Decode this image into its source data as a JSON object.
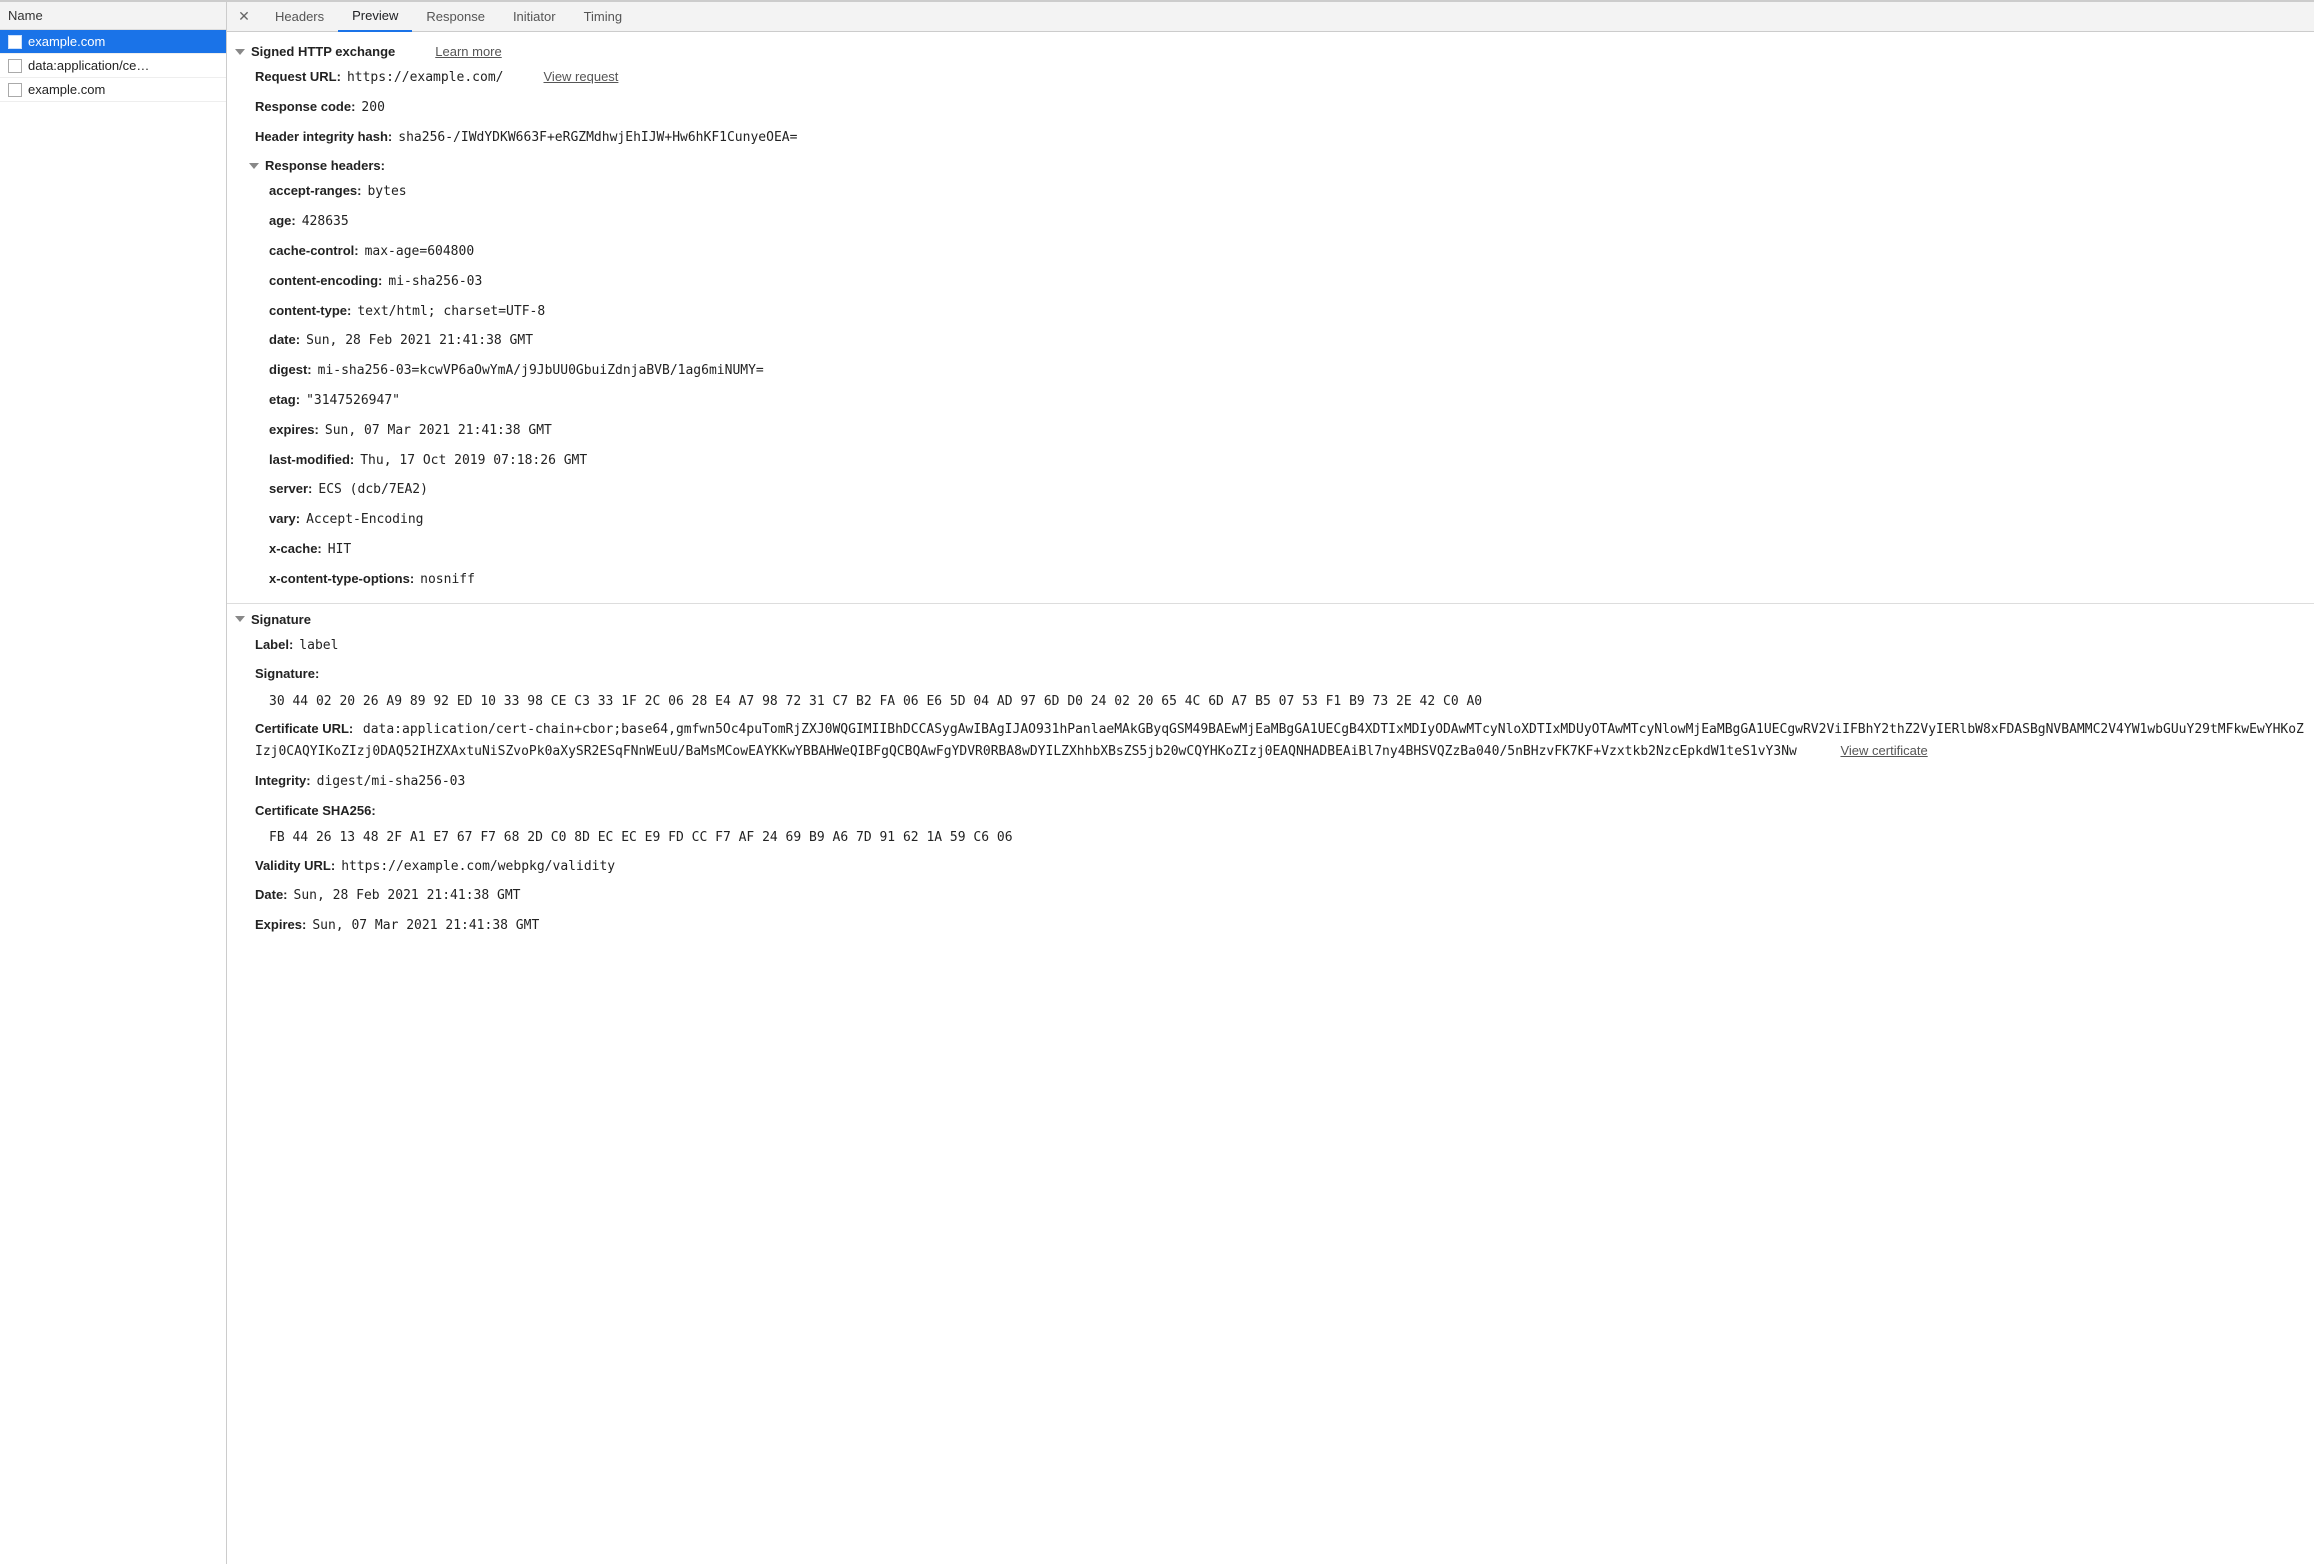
{
  "sidebar": {
    "header": "Name",
    "items": [
      {
        "label": "example.com",
        "selected": true
      },
      {
        "label": "data:application/ce…",
        "selected": false
      },
      {
        "label": "example.com",
        "selected": false
      }
    ]
  },
  "tabs": [
    "Headers",
    "Preview",
    "Response",
    "Initiator",
    "Timing"
  ],
  "active_tab": "Preview",
  "exchange": {
    "title": "Signed HTTP exchange",
    "learn_more": "Learn more",
    "request_url_label": "Request URL:",
    "request_url": "https://example.com/",
    "view_request": "View request",
    "response_code_label": "Response code:",
    "response_code": "200",
    "hih_label": "Header integrity hash:",
    "hih": "sha256-/IWdYDKW663F+eRGZMdhwjEhIJW+Hw6hKF1CunyeOEA=",
    "response_headers_label": "Response headers:",
    "headers": [
      {
        "k": "accept-ranges:",
        "v": "bytes"
      },
      {
        "k": "age:",
        "v": "428635"
      },
      {
        "k": "cache-control:",
        "v": "max-age=604800"
      },
      {
        "k": "content-encoding:",
        "v": "mi-sha256-03"
      },
      {
        "k": "content-type:",
        "v": "text/html; charset=UTF-8"
      },
      {
        "k": "date:",
        "v": "Sun, 28 Feb 2021 21:41:38 GMT"
      },
      {
        "k": "digest:",
        "v": "mi-sha256-03=kcwVP6aOwYmA/j9JbUU0GbuiZdnjaBVB/1ag6miNUMY="
      },
      {
        "k": "etag:",
        "v": "\"3147526947\""
      },
      {
        "k": "expires:",
        "v": "Sun, 07 Mar 2021 21:41:38 GMT"
      },
      {
        "k": "last-modified:",
        "v": "Thu, 17 Oct 2019 07:18:26 GMT"
      },
      {
        "k": "server:",
        "v": "ECS (dcb/7EA2)"
      },
      {
        "k": "vary:",
        "v": "Accept-Encoding"
      },
      {
        "k": "x-cache:",
        "v": "HIT"
      },
      {
        "k": "x-content-type-options:",
        "v": "nosniff"
      }
    ]
  },
  "signature": {
    "title": "Signature",
    "label_label": "Label:",
    "label": "label",
    "signature_label": "Signature:",
    "signature_hex": "30 44 02 20 26 A9 89 92 ED 10 33 98 CE C3 33 1F 2C 06 28 E4 A7 98 72 31 C7 B2 FA 06 E6 5D 04 AD 97 6D D0 24 02 20 65 4C 6D A7 B5 07 53 F1 B9 73 2E 42 C0 A0",
    "cert_url_label": "Certificate URL:",
    "cert_url": "data:application/cert-chain+cbor;base64,gmfwn5Oc4puTomRjZXJ0WQGIMIIBhDCCASygAwIBAgIJAO931hPanlaeMAkGByqGSM49BAEwMjEaMBgGA1UECgB4XDTIxMDIyODAwMTcyNloXDTIxMDUyOTAwMTcyNlowMjEaMBgGA1UECgwRV2ViIFBhY2thZ2VyIERlbW8xFDASBgNVBAMMC2V4YW1wbGUuY29tMFkwEwYHKoZIzj0CAQYIKoZIzj0DAQ52IHZXAxtuNiSZvoPk0aXySR2ESqFNnWEuU/BaMsMCowEAYKKwYBBAHWeQIBFgQCBQAwFgYDVR0RBA8wDYILZXhhbXBsZS5jb20wCQYHKoZIzj0EAQNHADBEAiBl7ny4BHSVQZzBa040/5nBHzvFK7KF+Vzxtkb2NzcEpkdW1teS1vY3Nw",
    "view_cert": "View certificate",
    "integrity_label": "Integrity:",
    "integrity": "digest/mi-sha256-03",
    "cert_sha_label": "Certificate SHA256:",
    "cert_sha": "FB 44 26 13 48 2F A1 E7 67 F7 68 2D C0 8D EC EC E9 FD CC F7 AF 24 69 B9 A6 7D 91 62 1A 59 C6 06",
    "validity_url_label": "Validity URL:",
    "validity_url": "https://example.com/webpkg/validity",
    "date_label": "Date:",
    "date": "Sun, 28 Feb 2021 21:41:38 GMT",
    "expires_label": "Expires:",
    "expires": "Sun, 07 Mar 2021 21:41:38 GMT"
  }
}
